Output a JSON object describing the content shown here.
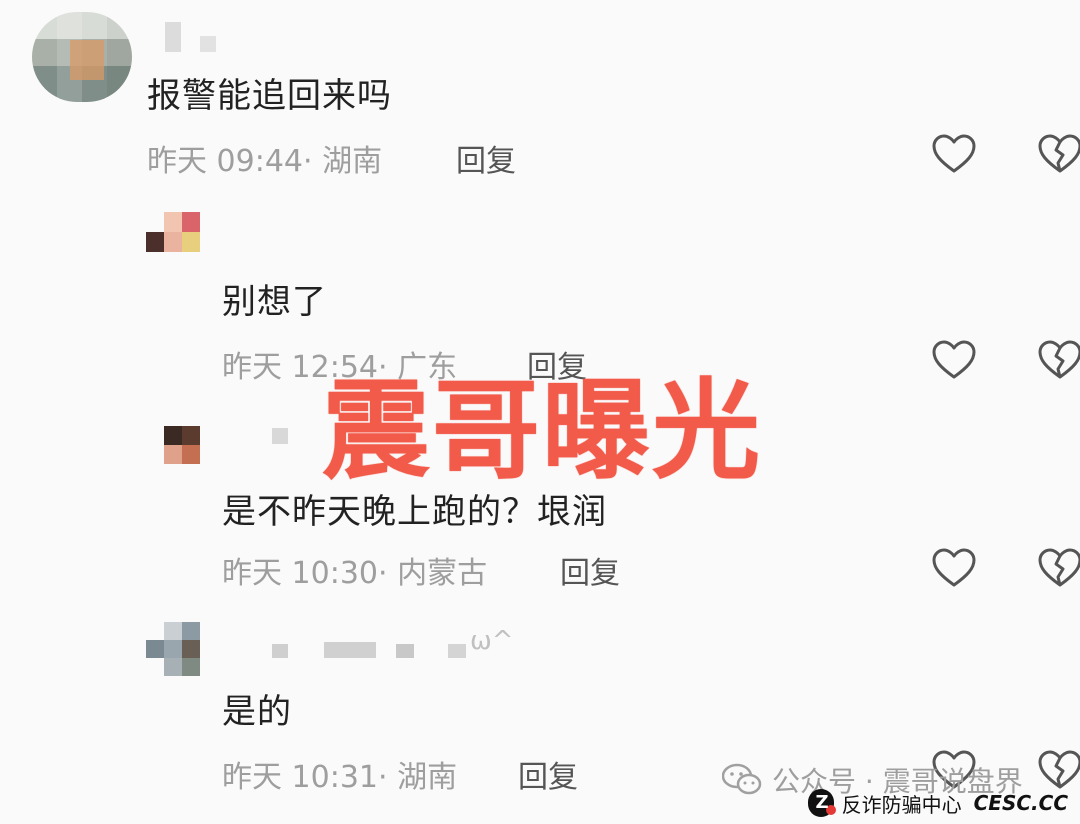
{
  "comments": [
    {
      "text": "报警能追回来吗",
      "meta": "昨天 09:44· 湖南",
      "reply_label": "回复"
    },
    {
      "text": "别想了",
      "meta": "昨天 12:54· 广东",
      "reply_label": "回复"
    },
    {
      "text": "是不昨天晚上跑的？垠润",
      "meta": "昨天 10:30· 内蒙古",
      "reply_label": "回复"
    },
    {
      "name_suffix": "ω^",
      "text": "是的",
      "meta": "昨天 10:31· 湖南",
      "reply_label": "回复"
    }
  ],
  "overlay": {
    "watermark_text": "震哥曝光"
  },
  "footer": {
    "wechat_text": "公众号 · 震哥说盘界",
    "logo_text": "反诈防骗中心",
    "logo_url": "CESC.CC"
  },
  "colors": {
    "watermark": "#f25a4a",
    "meta_gray": "#9e9e9e",
    "text_dark": "#222222"
  },
  "icons": [
    "like-heart-icon",
    "dislike-broken-heart-icon",
    "wechat-icon"
  ]
}
